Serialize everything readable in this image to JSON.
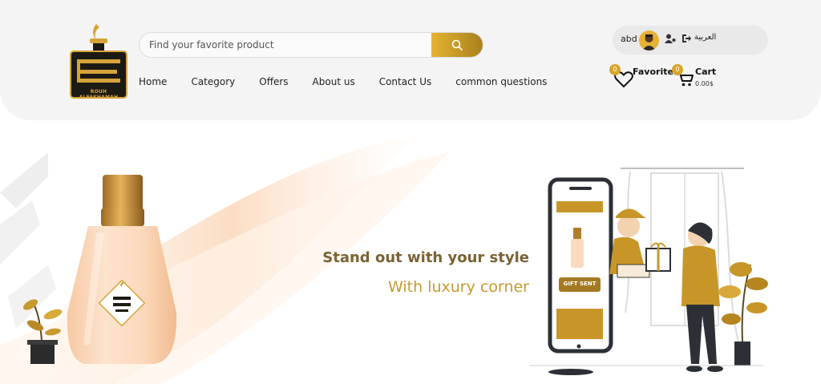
{
  "logo": {
    "brand_text": "ROUH ALFAKHAMAH",
    "brand_mark": "روح الفخامة"
  },
  "search": {
    "placeholder": "Find your favorite product",
    "icon": "search-icon"
  },
  "nav": {
    "items": [
      {
        "label": "Home"
      },
      {
        "label": "Category"
      },
      {
        "label": "Offers"
      },
      {
        "label": "About us"
      },
      {
        "label": "Contact Us"
      },
      {
        "label": "common questions"
      }
    ]
  },
  "user": {
    "name": "abd",
    "language_label": "العربية",
    "icons": [
      "avatar",
      "user-cog-icon",
      "logout-icon"
    ]
  },
  "favorite": {
    "label": "Favorite",
    "count": "0",
    "icon": "heart-icon"
  },
  "cart": {
    "label": "Cart",
    "count": "0",
    "total": "0.00$",
    "icon": "cart-icon"
  },
  "hero": {
    "headline": "Stand out with your style",
    "subline": "With luxury corner",
    "illustration_text": "GIFT SENT"
  },
  "colors": {
    "accent": "#d9a529",
    "accent_dark": "#a9811d",
    "headline": "#7b6234",
    "subline": "#c69a32",
    "header_bg": "#f4f4f4"
  }
}
